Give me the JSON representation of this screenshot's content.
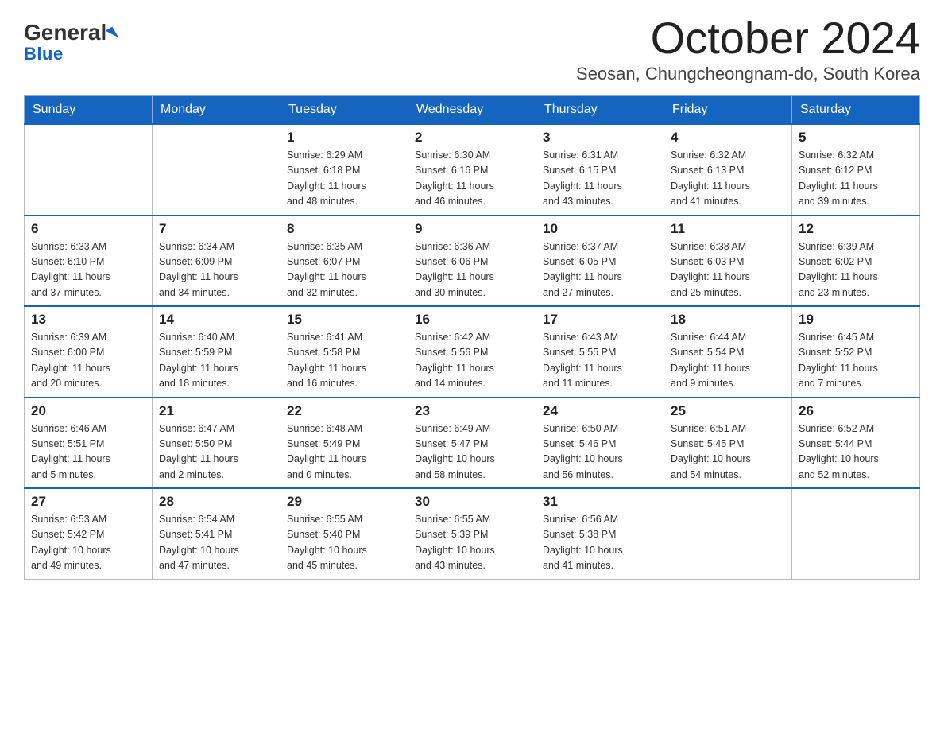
{
  "header": {
    "logo_general": "General",
    "logo_blue": "Blue",
    "month_title": "October 2024",
    "subtitle": "Seosan, Chungcheongnam-do, South Korea"
  },
  "weekdays": [
    "Sunday",
    "Monday",
    "Tuesday",
    "Wednesday",
    "Thursday",
    "Friday",
    "Saturday"
  ],
  "weeks": [
    [
      {
        "day": "",
        "info": ""
      },
      {
        "day": "",
        "info": ""
      },
      {
        "day": "1",
        "info": "Sunrise: 6:29 AM\nSunset: 6:18 PM\nDaylight: 11 hours\nand 48 minutes."
      },
      {
        "day": "2",
        "info": "Sunrise: 6:30 AM\nSunset: 6:16 PM\nDaylight: 11 hours\nand 46 minutes."
      },
      {
        "day": "3",
        "info": "Sunrise: 6:31 AM\nSunset: 6:15 PM\nDaylight: 11 hours\nand 43 minutes."
      },
      {
        "day": "4",
        "info": "Sunrise: 6:32 AM\nSunset: 6:13 PM\nDaylight: 11 hours\nand 41 minutes."
      },
      {
        "day": "5",
        "info": "Sunrise: 6:32 AM\nSunset: 6:12 PM\nDaylight: 11 hours\nand 39 minutes."
      }
    ],
    [
      {
        "day": "6",
        "info": "Sunrise: 6:33 AM\nSunset: 6:10 PM\nDaylight: 11 hours\nand 37 minutes."
      },
      {
        "day": "7",
        "info": "Sunrise: 6:34 AM\nSunset: 6:09 PM\nDaylight: 11 hours\nand 34 minutes."
      },
      {
        "day": "8",
        "info": "Sunrise: 6:35 AM\nSunset: 6:07 PM\nDaylight: 11 hours\nand 32 minutes."
      },
      {
        "day": "9",
        "info": "Sunrise: 6:36 AM\nSunset: 6:06 PM\nDaylight: 11 hours\nand 30 minutes."
      },
      {
        "day": "10",
        "info": "Sunrise: 6:37 AM\nSunset: 6:05 PM\nDaylight: 11 hours\nand 27 minutes."
      },
      {
        "day": "11",
        "info": "Sunrise: 6:38 AM\nSunset: 6:03 PM\nDaylight: 11 hours\nand 25 minutes."
      },
      {
        "day": "12",
        "info": "Sunrise: 6:39 AM\nSunset: 6:02 PM\nDaylight: 11 hours\nand 23 minutes."
      }
    ],
    [
      {
        "day": "13",
        "info": "Sunrise: 6:39 AM\nSunset: 6:00 PM\nDaylight: 11 hours\nand 20 minutes."
      },
      {
        "day": "14",
        "info": "Sunrise: 6:40 AM\nSunset: 5:59 PM\nDaylight: 11 hours\nand 18 minutes."
      },
      {
        "day": "15",
        "info": "Sunrise: 6:41 AM\nSunset: 5:58 PM\nDaylight: 11 hours\nand 16 minutes."
      },
      {
        "day": "16",
        "info": "Sunrise: 6:42 AM\nSunset: 5:56 PM\nDaylight: 11 hours\nand 14 minutes."
      },
      {
        "day": "17",
        "info": "Sunrise: 6:43 AM\nSunset: 5:55 PM\nDaylight: 11 hours\nand 11 minutes."
      },
      {
        "day": "18",
        "info": "Sunrise: 6:44 AM\nSunset: 5:54 PM\nDaylight: 11 hours\nand 9 minutes."
      },
      {
        "day": "19",
        "info": "Sunrise: 6:45 AM\nSunset: 5:52 PM\nDaylight: 11 hours\nand 7 minutes."
      }
    ],
    [
      {
        "day": "20",
        "info": "Sunrise: 6:46 AM\nSunset: 5:51 PM\nDaylight: 11 hours\nand 5 minutes."
      },
      {
        "day": "21",
        "info": "Sunrise: 6:47 AM\nSunset: 5:50 PM\nDaylight: 11 hours\nand 2 minutes."
      },
      {
        "day": "22",
        "info": "Sunrise: 6:48 AM\nSunset: 5:49 PM\nDaylight: 11 hours\nand 0 minutes."
      },
      {
        "day": "23",
        "info": "Sunrise: 6:49 AM\nSunset: 5:47 PM\nDaylight: 10 hours\nand 58 minutes."
      },
      {
        "day": "24",
        "info": "Sunrise: 6:50 AM\nSunset: 5:46 PM\nDaylight: 10 hours\nand 56 minutes."
      },
      {
        "day": "25",
        "info": "Sunrise: 6:51 AM\nSunset: 5:45 PM\nDaylight: 10 hours\nand 54 minutes."
      },
      {
        "day": "26",
        "info": "Sunrise: 6:52 AM\nSunset: 5:44 PM\nDaylight: 10 hours\nand 52 minutes."
      }
    ],
    [
      {
        "day": "27",
        "info": "Sunrise: 6:53 AM\nSunset: 5:42 PM\nDaylight: 10 hours\nand 49 minutes."
      },
      {
        "day": "28",
        "info": "Sunrise: 6:54 AM\nSunset: 5:41 PM\nDaylight: 10 hours\nand 47 minutes."
      },
      {
        "day": "29",
        "info": "Sunrise: 6:55 AM\nSunset: 5:40 PM\nDaylight: 10 hours\nand 45 minutes."
      },
      {
        "day": "30",
        "info": "Sunrise: 6:55 AM\nSunset: 5:39 PM\nDaylight: 10 hours\nand 43 minutes."
      },
      {
        "day": "31",
        "info": "Sunrise: 6:56 AM\nSunset: 5:38 PM\nDaylight: 10 hours\nand 41 minutes."
      },
      {
        "day": "",
        "info": ""
      },
      {
        "day": "",
        "info": ""
      }
    ]
  ]
}
